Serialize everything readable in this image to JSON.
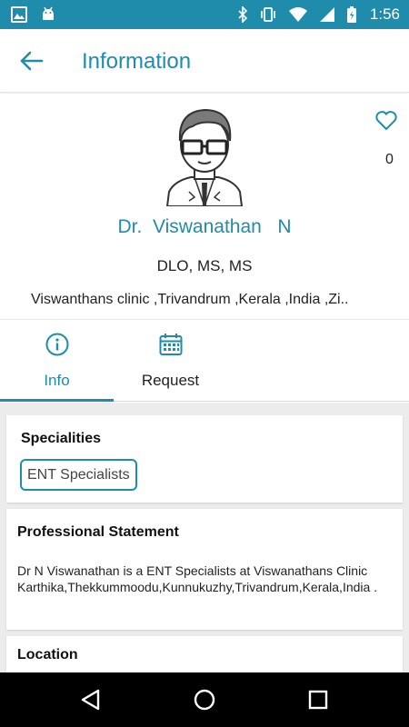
{
  "status_bar": {
    "time": "1:56",
    "left_icons": [
      "image-icon",
      "android-icon"
    ],
    "right_icons": [
      "bluetooth-icon",
      "vibrate-icon",
      "wifi-icon",
      "cellular-icon",
      "battery-icon"
    ]
  },
  "app_bar": {
    "title": "Information"
  },
  "profile": {
    "name": "Dr.  Viswanathan   N",
    "degrees": "DLO, MS, MS",
    "address": "Viswanthans clinic ,Trivandrum ,Kerala ,India ,Zi..",
    "favorite_count": "0"
  },
  "tabs": [
    {
      "label": "Info",
      "icon": "info-icon",
      "selected": true
    },
    {
      "label": "Request",
      "icon": "calendar-icon",
      "selected": false
    }
  ],
  "specialities": {
    "title": "Specialities",
    "items": [
      "ENT Specialists"
    ]
  },
  "professional_statement": {
    "title": "Professional Statement",
    "text": "Dr N Viswanathan is a ENT Specialists at Viswanathans Clinic Karthika,Thekkummoodu,Kunnukuzhy,Trivandrum,Kerala,India ."
  },
  "location": {
    "title": "Location"
  },
  "colors": {
    "accent": "#1f8cab",
    "background": "#ececec",
    "nav_bar": "#000000"
  }
}
